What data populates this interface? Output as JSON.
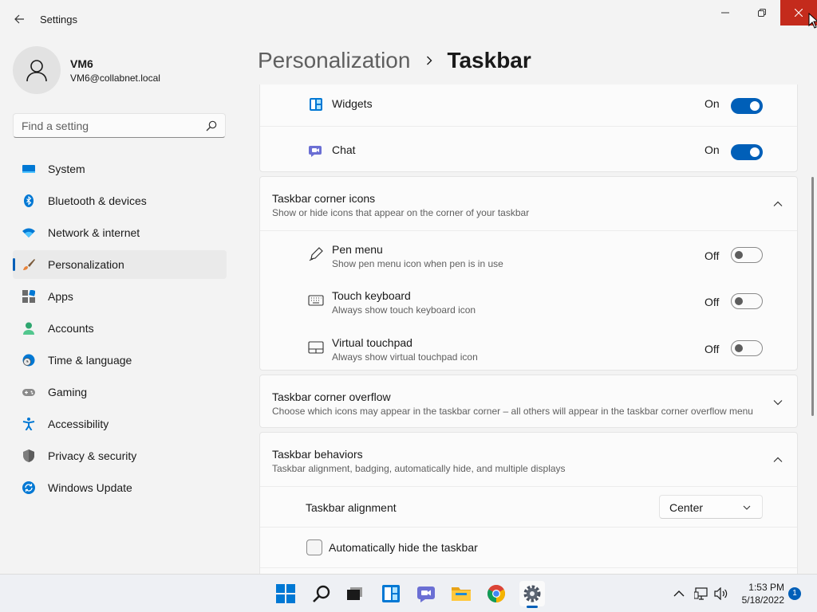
{
  "window": {
    "title": "Settings",
    "close_color": "#c42b1c",
    "accent_color": "#005fb8"
  },
  "user": {
    "name": "VM6",
    "email": "VM6@collabnet.local"
  },
  "search": {
    "placeholder": "Find a setting"
  },
  "sidebar": {
    "items": [
      {
        "label": "System",
        "icon": "monitor-icon",
        "active": false
      },
      {
        "label": "Bluetooth & devices",
        "icon": "bluetooth-icon",
        "active": false
      },
      {
        "label": "Network & internet",
        "icon": "wifi-icon",
        "active": false
      },
      {
        "label": "Personalization",
        "icon": "brush-icon",
        "active": true
      },
      {
        "label": "Apps",
        "icon": "apps-icon",
        "active": false
      },
      {
        "label": "Accounts",
        "icon": "person-icon",
        "active": false
      },
      {
        "label": "Time & language",
        "icon": "clock-globe-icon",
        "active": false
      },
      {
        "label": "Gaming",
        "icon": "gamepad-icon",
        "active": false
      },
      {
        "label": "Accessibility",
        "icon": "accessibility-icon",
        "active": false
      },
      {
        "label": "Privacy & security",
        "icon": "shield-icon",
        "active": false
      },
      {
        "label": "Windows Update",
        "icon": "update-icon",
        "active": false
      }
    ]
  },
  "breadcrumb": {
    "parent": "Personalization",
    "current": "Taskbar"
  },
  "taskbar_items": {
    "widgets": {
      "label": "Widgets",
      "state": "On"
    },
    "chat": {
      "label": "Chat",
      "state": "On"
    }
  },
  "corner_icons": {
    "title": "Taskbar corner icons",
    "subtitle": "Show or hide icons that appear on the corner of your taskbar",
    "items": [
      {
        "label": "Pen menu",
        "sub": "Show pen menu icon when pen is in use",
        "state": "Off"
      },
      {
        "label": "Touch keyboard",
        "sub": "Always show touch keyboard icon",
        "state": "Off"
      },
      {
        "label": "Virtual touchpad",
        "sub": "Always show virtual touchpad icon",
        "state": "Off"
      }
    ]
  },
  "corner_overflow": {
    "title": "Taskbar corner overflow",
    "subtitle": "Choose which icons may appear in the taskbar corner – all others will appear in the taskbar corner overflow menu"
  },
  "behaviors": {
    "title": "Taskbar behaviors",
    "subtitle": "Taskbar alignment, badging, automatically hide, and multiple displays",
    "alignment_label": "Taskbar alignment",
    "alignment_value": "Center",
    "autohide_label": "Automatically hide the taskbar"
  },
  "tray": {
    "time": "1:53 PM",
    "date": "5/18/2022",
    "notifications": "1"
  }
}
